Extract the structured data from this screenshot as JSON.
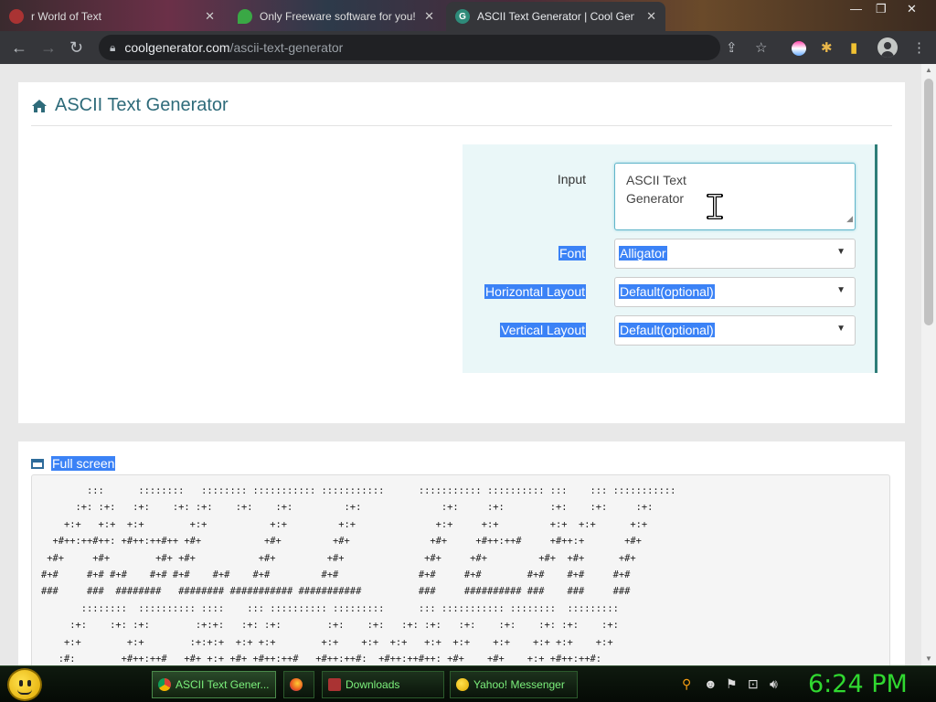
{
  "browser": {
    "tabs": [
      {
        "title": "r World of Text",
        "icon": "text-world-icon"
      },
      {
        "title": "Only Freeware software for you!",
        "icon": "freeware-icon"
      },
      {
        "title": "ASCII Text Generator | Cool Generator",
        "icon": "coolgenerator-icon"
      }
    ],
    "address": {
      "host": "coolgenerator.com",
      "path": "/ascii-text-generator"
    }
  },
  "page": {
    "title": "ASCII Text Generator",
    "form": {
      "input_label": "Input",
      "input_value_line1": "ASCII Text",
      "input_value_line2": "Generator",
      "font_label": "Font",
      "font_value": "Alligator",
      "hlayout_label": "Horizontal Layout",
      "hlayout_value": "Default(optional)",
      "vlayout_label": "Vertical Layout",
      "vlayout_value": "Default(optional)"
    },
    "output": {
      "fullscreen_label": "Full screen",
      "ascii_art": "        :::      ::::::::   :::::::: ::::::::::: :::::::::::      ::::::::::: :::::::::: :::    ::: :::::::::::\n      :+: :+:   :+:    :+: :+:    :+:    :+:         :+:              :+:     :+:        :+:    :+:     :+:\n    +:+   +:+  +:+        +:+           +:+         +:+              +:+     +:+         +:+  +:+      +:+\n  +#++:++#++: +#++:++#++ +#+           +#+         +#+              +#+     +#++:++#     +#++:+       +#+\n +#+     +#+        +#+ +#+           +#+         +#+              +#+     +#+         +#+  +#+      +#+\n#+#     #+# #+#    #+# #+#    #+#    #+#         #+#              #+#     #+#        #+#    #+#     #+#\n###     ###  ########   ######## ########### ###########          ###     ########## ###    ###     ###\n       ::::::::  :::::::::: ::::    ::: :::::::::: :::::::::      ::: ::::::::::: ::::::::  :::::::::\n     :+:    :+: :+:        :+:+:   :+: :+:        :+:    :+:   :+: :+:   :+:    :+:    :+: :+:    :+:\n    +:+        +:+        :+:+:+  +:+ +:+        +:+    +:+  +:+   +:+  +:+    +:+    +:+ +:+    +:+\n   :#:        +#++:++#   +#+ +:+ +#+ +#++:++#   +#++:++#:  +#++:++#++: +#+    +#+    +:+ +#++:++#:"
    }
  },
  "taskbar": {
    "buttons": [
      {
        "label": "ASCII Text Gener..."
      },
      {
        "label": ""
      },
      {
        "label": "Downloads"
      },
      {
        "label": "Yahoo! Messenger"
      }
    ],
    "clock": "6:24 PM"
  },
  "colors": {
    "accent": "#2e6b7a",
    "selection": "#3b82f6",
    "panel_border": "#2e7d78",
    "clock_green": "#30d830"
  }
}
